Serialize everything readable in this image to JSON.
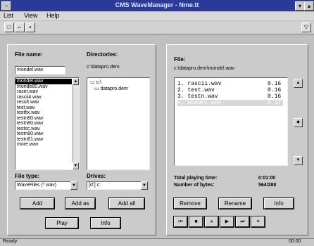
{
  "window": {
    "title": "CMS WaveManager - Nme.tt"
  },
  "menu": [
    "List",
    "View",
    "Help"
  ],
  "left": {
    "file_name_label": "File name:",
    "file_name_value": "mondel.wav",
    "directories_label": "Directories:",
    "current_dir": "c:\\datapro.dem",
    "files": [
      "mondel.wav",
      "monde80.wav",
      "raser.wav",
      "rascii4.wav",
      "result.wav",
      "test.wav",
      "testfix.wav",
      "testn80.wav",
      "testn80.wav",
      "testsc.wav",
      "testn80.wav",
      "testn81.wav",
      "more.wav"
    ],
    "dirs": [
      "c:\\",
      "datapro.dem"
    ],
    "file_type_label": "File type:",
    "file_type_value": "WaveFiles (*.wav)",
    "drives_label": "Drives:",
    "drive_value": "[d:] c:",
    "btn_add": "Add",
    "btn_add_as": "Add as",
    "btn_add_all": "Add all",
    "btn_play": "Play",
    "btn_info": "Info"
  },
  "right": {
    "file_label": "File:",
    "file_path": "c:\\datapro.dem\\mondel.wav",
    "playlist": [
      {
        "text": "1. rascii.wav",
        "time": "0.16"
      },
      {
        "text": "2. test.wav",
        "time": "0.16"
      },
      {
        "text": "3. testn.wav",
        "time": "0.16"
      },
      {
        "text": "4. mondel.wav",
        "time": "0.17"
      }
    ],
    "total_label": "Total playing time:",
    "total_value": "0:01:00",
    "bytes_label": "Number of bytes:",
    "bytes_value": "564/288",
    "btn_remove": "Remove",
    "btn_rename": "Rename",
    "btn_info": "Info",
    "play_buttons": [
      "⏮",
      "■",
      "⏸",
      "▶",
      "⏭",
      "≡"
    ]
  },
  "status": {
    "left": "Ready",
    "right": "00:00"
  }
}
